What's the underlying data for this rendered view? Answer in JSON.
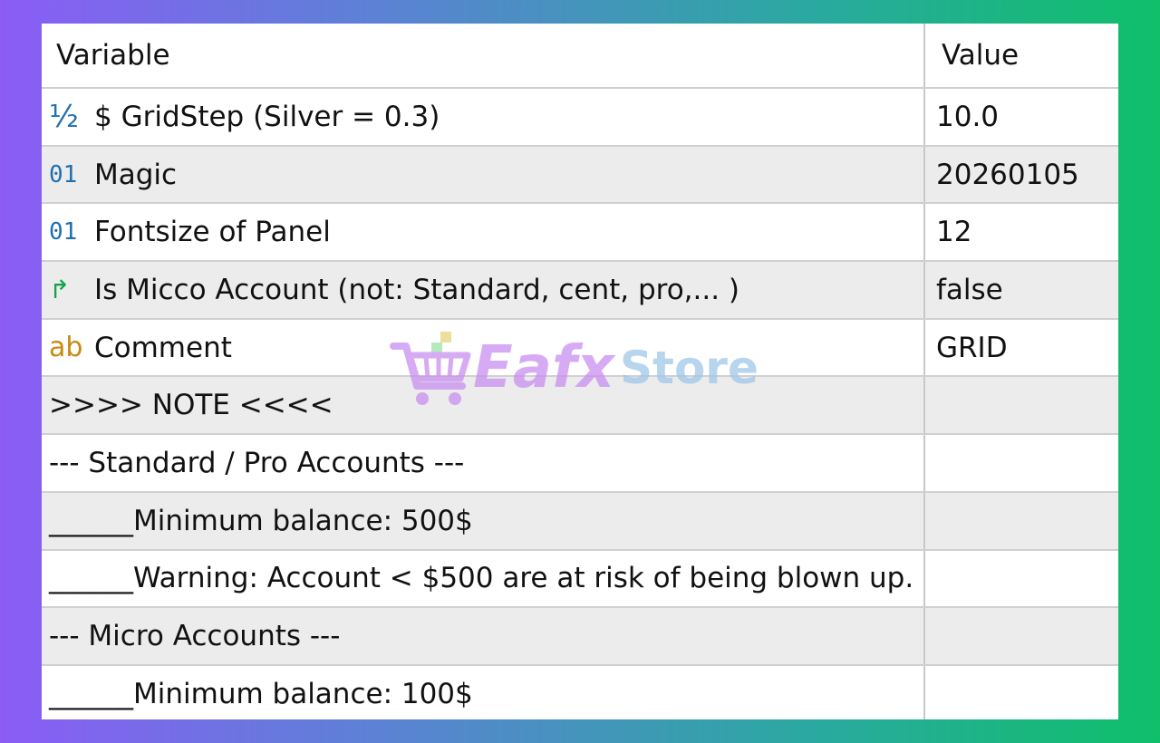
{
  "table": {
    "header_variable": "Variable",
    "header_value": "Value",
    "rows": [
      {
        "icon": "fraction-icon",
        "glyph": "½",
        "variable": "$ GridStep (Silver = 0.3)",
        "value": "10.0"
      },
      {
        "icon": "integer-icon",
        "glyph": "01",
        "variable": "Magic",
        "value": "20260105"
      },
      {
        "icon": "integer-icon",
        "glyph": "01",
        "variable": "Fontsize of Panel",
        "value": "12"
      },
      {
        "icon": "boolean-icon",
        "glyph": "↱",
        "variable": "Is Micco Account (not: Standard, cent, pro,... )",
        "value": "false"
      },
      {
        "icon": "string-icon",
        "glyph": "ab",
        "variable": "Comment",
        "value": "GRID"
      },
      {
        "icon": "",
        "glyph": "",
        "variable": ">>>> NOTE <<<<",
        "value": ""
      },
      {
        "icon": "",
        "glyph": "",
        "variable": "--- Standard / Pro Accounts ---",
        "value": ""
      },
      {
        "icon": "",
        "glyph": "",
        "variable": "______Minimum balance: 500$",
        "value": ""
      },
      {
        "icon": "",
        "glyph": "",
        "variable": "______Warning: Account < $500 are at risk of being blown up.",
        "value": ""
      },
      {
        "icon": "",
        "glyph": "",
        "variable": "--- Micro Accounts ---",
        "value": ""
      },
      {
        "icon": "",
        "glyph": "",
        "variable": "______Minimum balance: 100$",
        "value": ""
      }
    ]
  },
  "watermark": {
    "text1": "Eafx",
    "text2": "Store",
    "icon": "shopping-cart-icon"
  }
}
